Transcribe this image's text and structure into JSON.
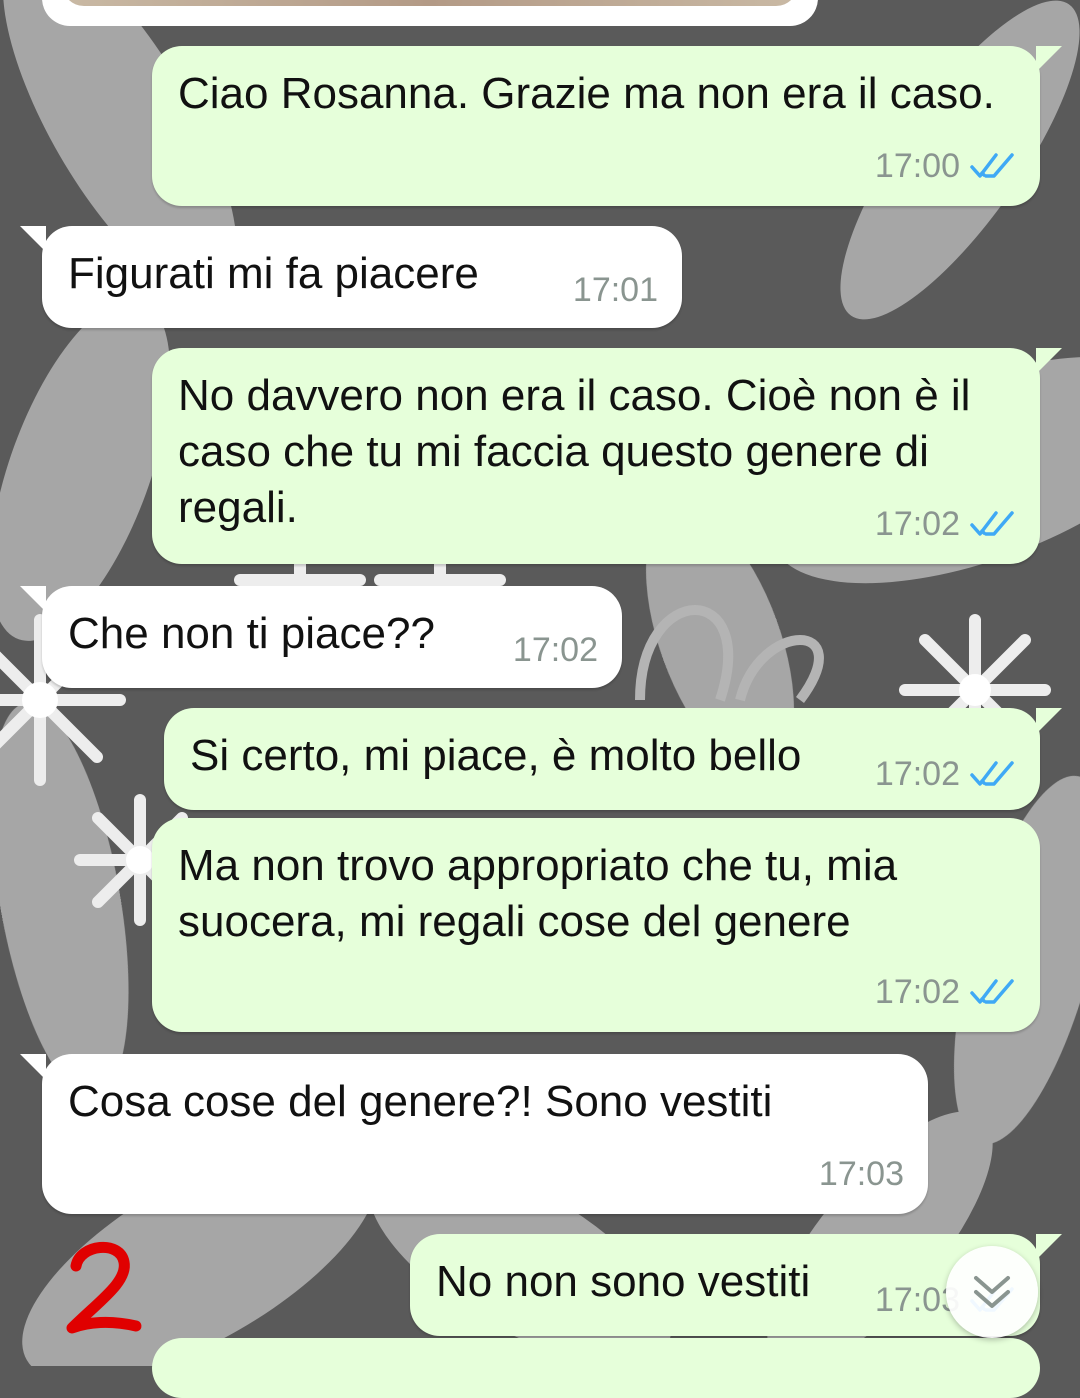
{
  "colors": {
    "outgoing_bubble": "#e6ffda",
    "incoming_bubble": "#ffffff",
    "timestamp": "#8a9590",
    "read_ticks": "#3fa9f5",
    "wallpaper_dark": "#5a5a5a",
    "wallpaper_light": "#b4b4b4",
    "annotation": "#e00000"
  },
  "messages": [
    {
      "direction": "outgoing",
      "text": "Ciao Rosanna. Grazie ma non era il caso.",
      "time": "17:00",
      "status_icon": "double-check-read-icon"
    },
    {
      "direction": "incoming",
      "text": "Figurati mi fa piacere",
      "time": "17:01"
    },
    {
      "direction": "outgoing",
      "text": "No davvero non era il caso. Cioè non è il caso che tu mi faccia questo genere di regali.",
      "time": "17:02",
      "status_icon": "double-check-read-icon"
    },
    {
      "direction": "incoming",
      "text": "Che non ti piace??",
      "time": "17:02"
    },
    {
      "direction": "outgoing",
      "text": "Si certo, mi piace, è molto bello",
      "time": "17:02",
      "status_icon": "double-check-read-icon"
    },
    {
      "direction": "outgoing",
      "text": "Ma non trovo appropriato che tu, mia suocera, mi regali cose del genere",
      "time": "17:02",
      "status_icon": "double-check-read-icon"
    },
    {
      "direction": "incoming",
      "text": "Cosa cose del genere?! Sono vestiti",
      "time": "17:03"
    },
    {
      "direction": "outgoing",
      "text": "No non sono vestiti",
      "time": "17:03",
      "status_icon": "double-check-read-icon"
    }
  ],
  "overlay": {
    "annotation_text": "2",
    "scroll_button_icon": "chevron-double-down-icon"
  }
}
